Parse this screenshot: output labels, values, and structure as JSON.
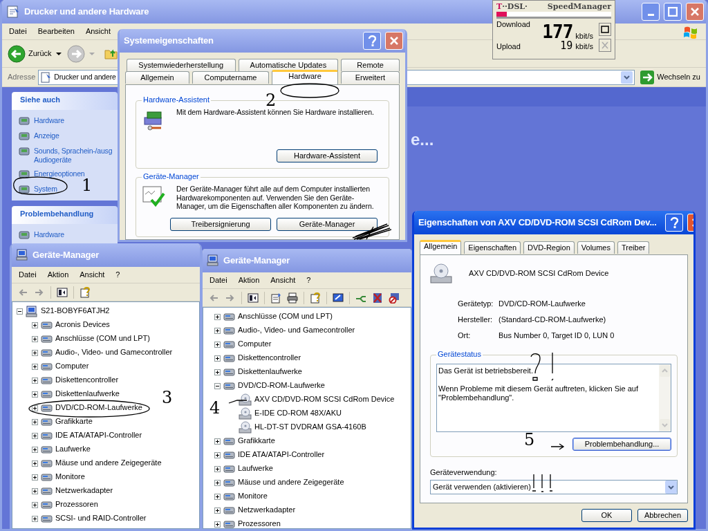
{
  "explorer": {
    "title": "Drucker und andere Hardware",
    "active": false,
    "menu": [
      "Datei",
      "Bearbeiten",
      "Ansicht"
    ],
    "back_label": "Zurück",
    "address_label": "Adresse",
    "address_value": "Drucker und andere",
    "go_label": "Wechseln zu",
    "heading_fragment": "e...",
    "panels": [
      {
        "title": "Siehe auch",
        "items": [
          {
            "lines": [
              "Hardware"
            ]
          },
          {
            "lines": [
              "Anzeige"
            ]
          },
          {
            "lines": [
              "Sounds, Sprachein-/ausg",
              "Audiogeräte"
            ]
          },
          {
            "lines": [
              "Energieoptionen"
            ]
          },
          {
            "lines": [
              "System"
            ]
          }
        ]
      },
      {
        "title": "Problembehandlung",
        "items": [
          {
            "lines": [
              "Hardware"
            ]
          }
        ]
      }
    ]
  },
  "speed_manager": {
    "logo_letter": "T",
    "logo_text": "··DSL·",
    "title": "SpeedManager",
    "level": 0.09,
    "download_label": "Download",
    "download_value": "177",
    "download_unit": "kbit/s",
    "upload_label": "Upload",
    "upload_value": "19",
    "upload_unit": "kbit/s"
  },
  "system_dialog": {
    "title": "Systemeigenschaften",
    "active": false,
    "tab_rows": [
      [
        {
          "label": "Systemwiederherstellung",
          "selected": false
        },
        {
          "label": "Automatische Updates",
          "selected": false
        },
        {
          "label": "Remote",
          "selected": false
        }
      ],
      [
        {
          "label": "Allgemein",
          "selected": false
        },
        {
          "label": "Computername",
          "selected": false
        },
        {
          "label": "Hardware",
          "selected": true
        },
        {
          "label": "Erweitert",
          "selected": false
        }
      ]
    ],
    "groups": [
      {
        "title": "Hardware-Assistent",
        "text": "Mit dem Hardware-Assistent können Sie Hardware installieren.",
        "buttons": [
          "Hardware-Assistent"
        ]
      },
      {
        "title": "Geräte-Manager",
        "text": "Der Geräte-Manager führt alle auf dem Computer installierten Hardwarekomponenten auf. Verwenden Sie den Geräte-Manager, um die Eigenschaften aller Komponenten zu ändern.",
        "buttons": [
          "Treibersignierung",
          "Geräte-Manager"
        ]
      }
    ]
  },
  "device_managers": [
    {
      "title": "Geräte-Manager",
      "active": false,
      "kind": "basic",
      "menu": [
        "Datei",
        "Aktion",
        "Ansicht",
        "?"
      ],
      "items": [
        {
          "label": "S21-BOBYF6ATJH2",
          "expanded": true,
          "children": [
            {
              "label": "Acronis Devices",
              "expanded": false
            },
            {
              "label": "Anschlüsse (COM und LPT)",
              "expanded": false
            },
            {
              "label": "Audio-, Video- und Gamecontroller",
              "expanded": false
            },
            {
              "label": "Computer",
              "expanded": false
            },
            {
              "label": "Diskettencontroller",
              "expanded": false
            },
            {
              "label": "Diskettenlaufwerke",
              "expanded": false
            },
            {
              "label": "DVD/CD-ROM-Laufwerke",
              "expanded": false
            },
            {
              "label": "Grafikkarte",
              "expanded": false
            },
            {
              "label": "IDE ATA/ATAPI-Controller",
              "expanded": false
            },
            {
              "label": "Laufwerke",
              "expanded": false
            },
            {
              "label": "Mäuse und andere Zeigegeräte",
              "expanded": false
            },
            {
              "label": "Monitore",
              "expanded": false
            },
            {
              "label": "Netzwerkadapter",
              "expanded": false
            },
            {
              "label": "Prozessoren",
              "expanded": false
            },
            {
              "label": "SCSI- und RAID-Controller",
              "expanded": false
            }
          ]
        }
      ]
    },
    {
      "title": "Geräte-Manager",
      "active": false,
      "kind": "full",
      "menu": [
        "Datei",
        "Aktion",
        "Ansicht",
        "?"
      ],
      "items": [
        {
          "label": "Anschlüsse (COM und LPT)",
          "expanded": false
        },
        {
          "label": "Audio-, Video- und Gamecontroller",
          "expanded": false
        },
        {
          "label": "Computer",
          "expanded": false
        },
        {
          "label": "Diskettencontroller",
          "expanded": false
        },
        {
          "label": "Diskettenlaufwerke",
          "expanded": false
        },
        {
          "label": "DVD/CD-ROM-Laufwerke",
          "expanded": true,
          "children": [
            {
              "label": "AXV CD/DVD-ROM SCSI CdRom Device"
            },
            {
              "label": "E-IDE CD-ROM 48X/AKU"
            },
            {
              "label": "HL-DT-ST DVDRAM GSA-4160B"
            }
          ]
        },
        {
          "label": "Grafikkarte",
          "expanded": false
        },
        {
          "label": "IDE ATA/ATAPI-Controller",
          "expanded": false
        },
        {
          "label": "Laufwerke",
          "expanded": false
        },
        {
          "label": "Mäuse und andere Zeigegeräte",
          "expanded": false
        },
        {
          "label": "Monitore",
          "expanded": false
        },
        {
          "label": "Netzwerkadapter",
          "expanded": false
        },
        {
          "label": "Prozessoren",
          "expanded": false
        }
      ]
    }
  ],
  "properties_dialog": {
    "title": "Eigenschaften von AXV CD/DVD-ROM SCSI CdRom Dev...",
    "active": true,
    "tabs": [
      {
        "label": "Allgemein",
        "selected": true
      },
      {
        "label": "Eigenschaften",
        "selected": false
      },
      {
        "label": "DVD-Region",
        "selected": false
      },
      {
        "label": "Volumes",
        "selected": false
      },
      {
        "label": "Treiber",
        "selected": false
      }
    ],
    "device_name": "AXV CD/DVD-ROM SCSI CdRom Device",
    "fields": [
      {
        "label": "Gerätetyp:",
        "value": "DVD/CD-ROM-Laufwerke"
      },
      {
        "label": "Hersteller:",
        "value": "(Standard-CD-ROM-Laufwerke)"
      },
      {
        "label": "Ort:",
        "value": "Bus Number 0, Target ID 0, LUN 0"
      }
    ],
    "status_title": "Gerätestatus",
    "status_lines": [
      "Das Gerät ist betriebsbereit.",
      "Wenn Probleme mit diesem Gerät auftreten, klicken Sie auf \"Problembehandlung\"."
    ],
    "troubleshoot_button": "Problembehandlung...",
    "usage_label": "Geräteverwendung:",
    "usage_value": "Gerät verwenden (aktivieren)",
    "buttons": [
      "OK",
      "Abbrechen"
    ]
  },
  "annotations": [
    {
      "text": "1"
    },
    {
      "text": "2"
    },
    {
      "text": "3"
    },
    {
      "text": "4"
    },
    {
      "text": "5"
    }
  ]
}
